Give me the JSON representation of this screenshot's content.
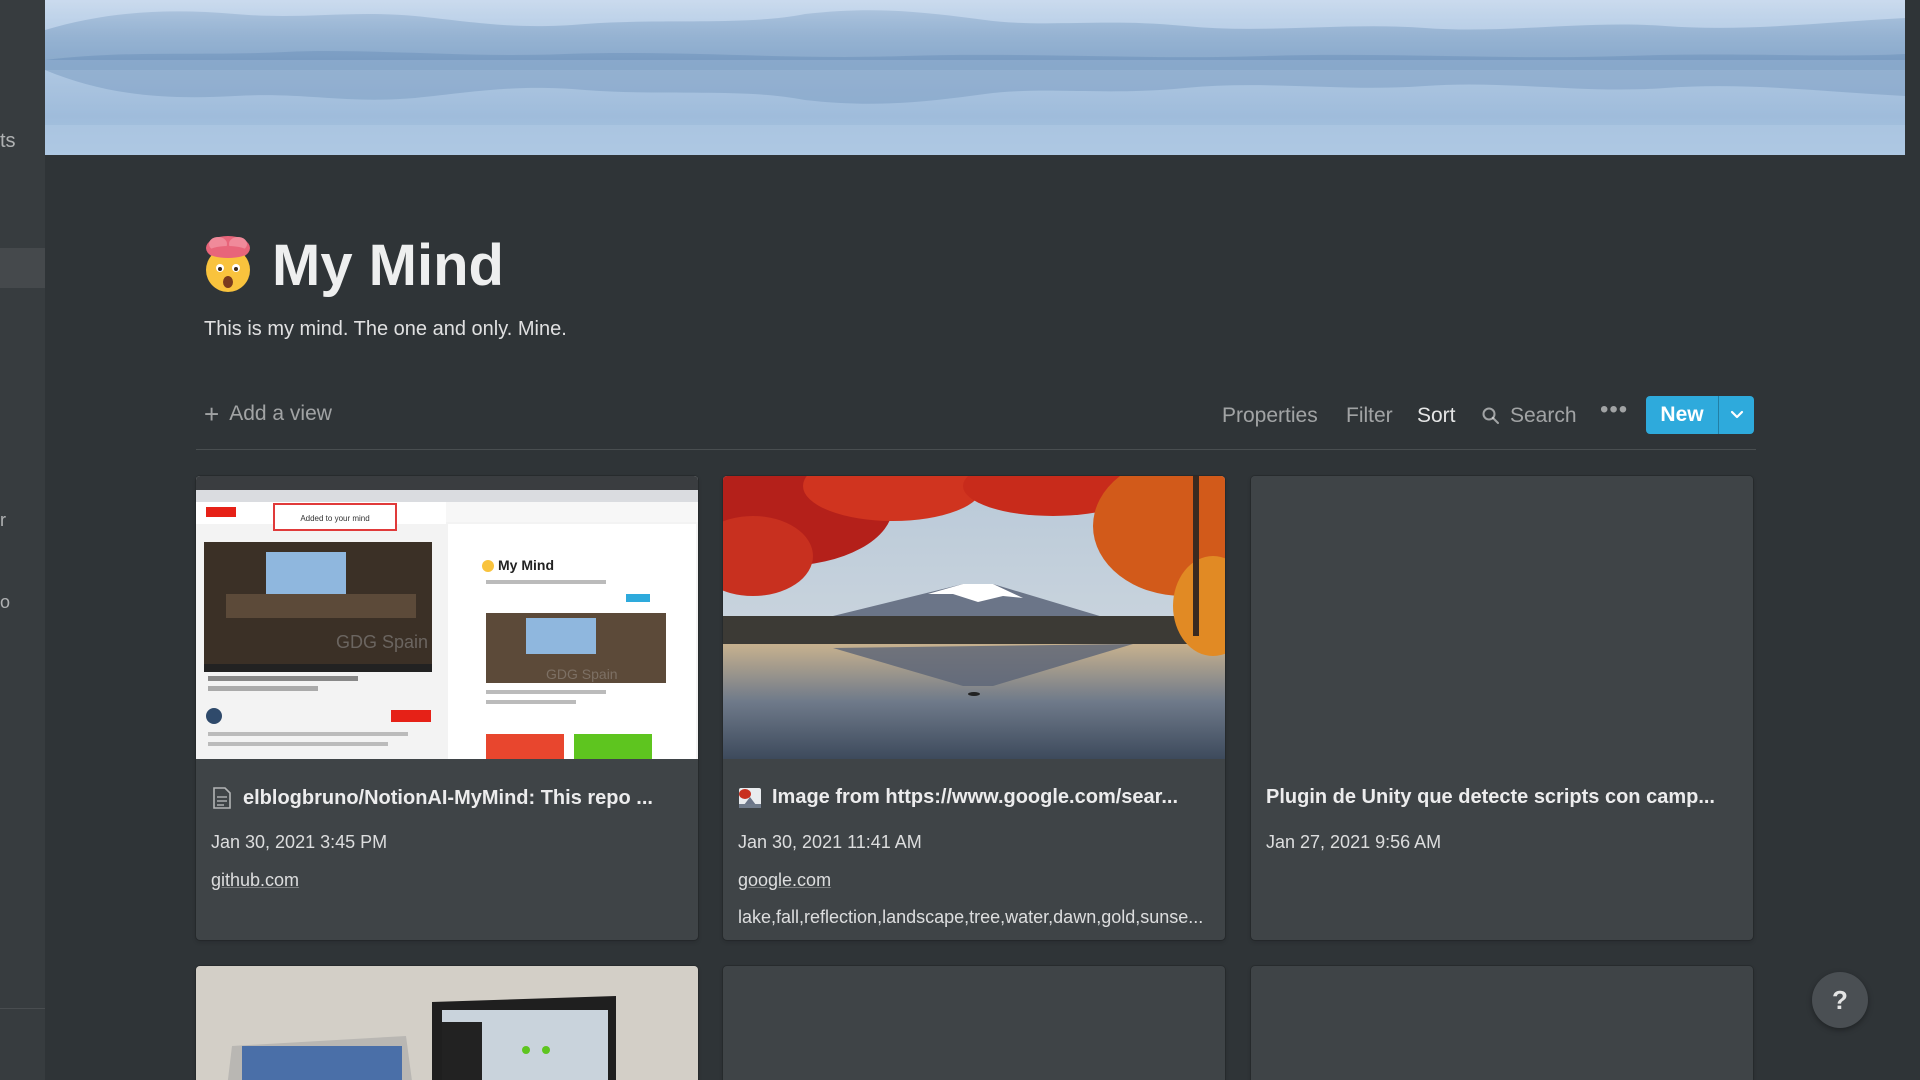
{
  "sidebar": {
    "fragments": [
      "ts",
      "r",
      "o"
    ]
  },
  "page": {
    "title": "My Mind",
    "icon": "exploding-head-emoji",
    "description": "This is my mind. The one and only. Mine."
  },
  "toolbar": {
    "add_view": "Add a view",
    "properties": "Properties",
    "filter": "Filter",
    "sort": "Sort",
    "search": "Search",
    "more": "•••",
    "new": "New",
    "accent": "#2eaadc"
  },
  "cards": [
    {
      "title": "elblogbruno/NotionAI-MyMind: This repo ...",
      "icon": "page-icon",
      "date": "Jan 30, 2021 3:45 PM",
      "url": "github.com",
      "tags": "",
      "thumb": {
        "left_label": "Added to your mind",
        "right_title": "My Mind",
        "slide_text": "GDG Spain"
      }
    },
    {
      "title": "Image from https://www.google.com/sear...",
      "icon": "image-icon",
      "date": "Jan 30, 2021 11:41 AM",
      "url": "google.com",
      "tags": "lake,fall,reflection,landscape,tree,water,dawn,gold,sunse..."
    },
    {
      "title": "Plugin de Unity que detecte scripts con camp...",
      "icon": "",
      "date": "Jan 27, 2021 9:56 AM",
      "url": "",
      "tags": ""
    }
  ],
  "help": "?"
}
